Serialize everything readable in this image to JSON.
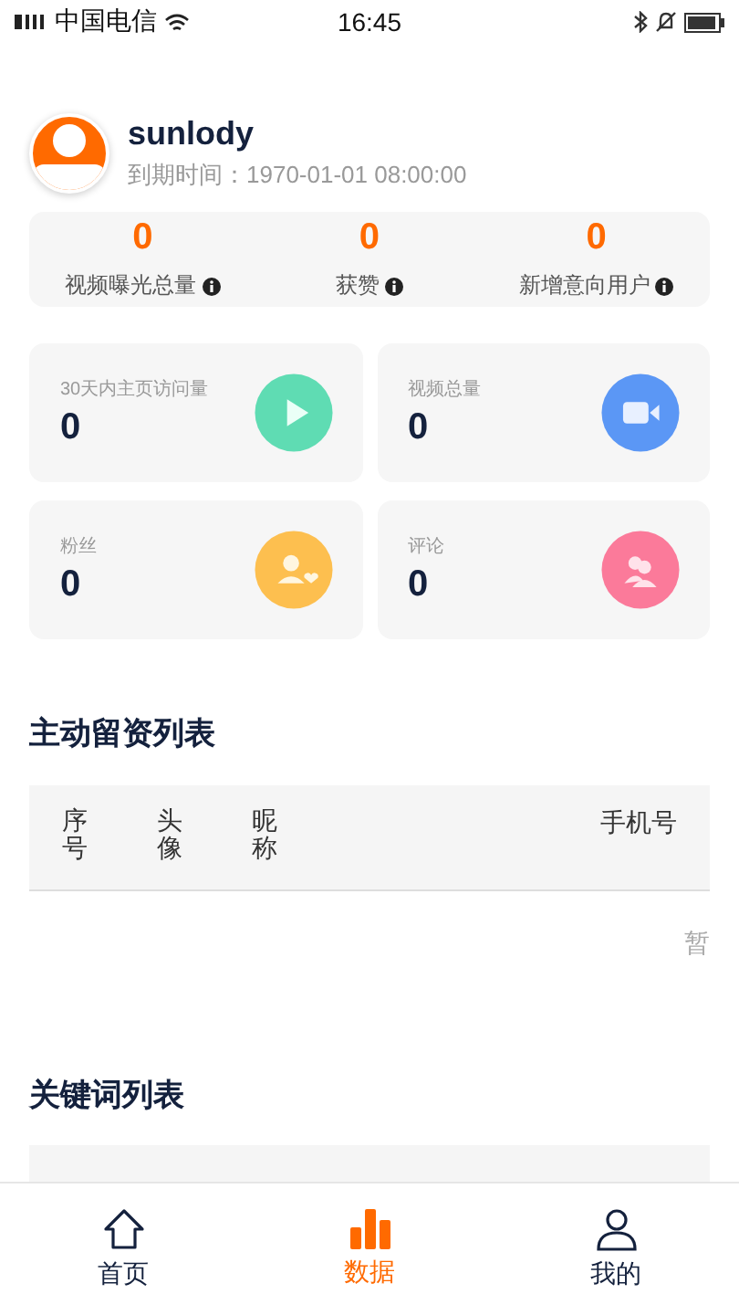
{
  "status_bar": {
    "carrier": "中国电信",
    "time": "16:45"
  },
  "profile": {
    "name": "sunlody",
    "expiry": "到期时间：1970-01-01 08:00:00"
  },
  "summary": [
    {
      "value": "0",
      "label": "视频曝光总量"
    },
    {
      "value": "0",
      "label": "获赞"
    },
    {
      "value": "0",
      "label": "新增意向用户"
    }
  ],
  "metrics": [
    {
      "label": "30天内主页访问量",
      "value": "0",
      "kind": "play",
      "color": "#5fdcb3"
    },
    {
      "label": "视频总量",
      "value": "0",
      "kind": "video",
      "color": "#5b97f5"
    },
    {
      "label": "粉丝",
      "value": "0",
      "kind": "fan",
      "color": "#fdbf4f"
    },
    {
      "label": "评论",
      "value": "0",
      "kind": "users",
      "color": "#fb7a9a"
    }
  ],
  "leads_table": {
    "title": "主动留资列表",
    "columns": [
      "序号",
      "头像",
      "昵称",
      "手机号"
    ],
    "empty_text": "暂"
  },
  "keywords_table": {
    "title": "关键词列表"
  },
  "tab_bar": [
    {
      "label": "首页",
      "kind": "home",
      "selected": false
    },
    {
      "label": "数据",
      "kind": "chart",
      "selected": true
    },
    {
      "label": "我的",
      "kind": "user",
      "selected": false
    }
  ]
}
